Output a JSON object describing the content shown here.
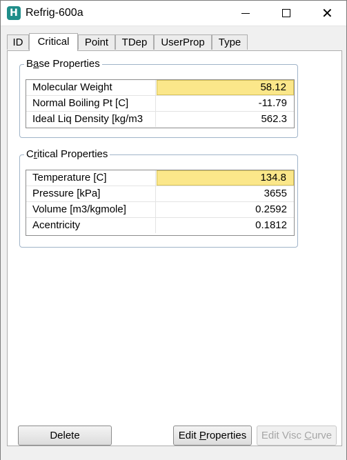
{
  "window": {
    "title": "Refrig-600a",
    "icon": "app-logo-icon",
    "icon_letter": "H",
    "controls": {
      "minimize": "minimize-icon",
      "maximize": "maximize-icon",
      "close": "close-icon"
    },
    "close_glyph": "✕"
  },
  "tabs": [
    {
      "label": "ID",
      "active": false
    },
    {
      "label": "Critical",
      "active": true
    },
    {
      "label": "Point",
      "active": false
    },
    {
      "label": "TDep",
      "active": false
    },
    {
      "label": "UserProp",
      "active": false
    },
    {
      "label": "Type",
      "active": false
    }
  ],
  "base_properties": {
    "title_prefix": "B",
    "title_mnemonic": "a",
    "title_suffix": "se Properties",
    "rows": [
      {
        "label": "Molecular Weight",
        "value": "58.12",
        "highlighted": true
      },
      {
        "label": "Normal Boiling Pt [C]",
        "value": "-11.79",
        "highlighted": false
      },
      {
        "label": "Ideal Liq Density [kg/m3",
        "value": "562.3",
        "highlighted": false
      }
    ]
  },
  "critical_properties": {
    "title_prefix": "C",
    "title_mnemonic": "r",
    "title_suffix": "itical Properties",
    "rows": [
      {
        "label": "Temperature [C]",
        "value": "134.8",
        "highlighted": true
      },
      {
        "label": "Pressure [kPa]",
        "value": "3655",
        "highlighted": false
      },
      {
        "label": "Volume [m3/kgmole]",
        "value": "0.2592",
        "highlighted": false
      },
      {
        "label": "Acentricity",
        "value": "0.1812",
        "highlighted": false
      }
    ]
  },
  "buttons": {
    "delete": {
      "label": "Delete",
      "enabled": true
    },
    "edit_properties": {
      "prefix": "Edit ",
      "mnemonic": "P",
      "suffix": "roperties",
      "enabled": true
    },
    "edit_visc_curve": {
      "prefix": "Edit Visc ",
      "mnemonic": "C",
      "suffix": "urve",
      "enabled": false
    }
  },
  "colors": {
    "highlight": "#fbe78a",
    "app_icon": "#1f8e8a",
    "group_border": "#9fb3c8",
    "disabled_text": "#a6a6a6"
  }
}
